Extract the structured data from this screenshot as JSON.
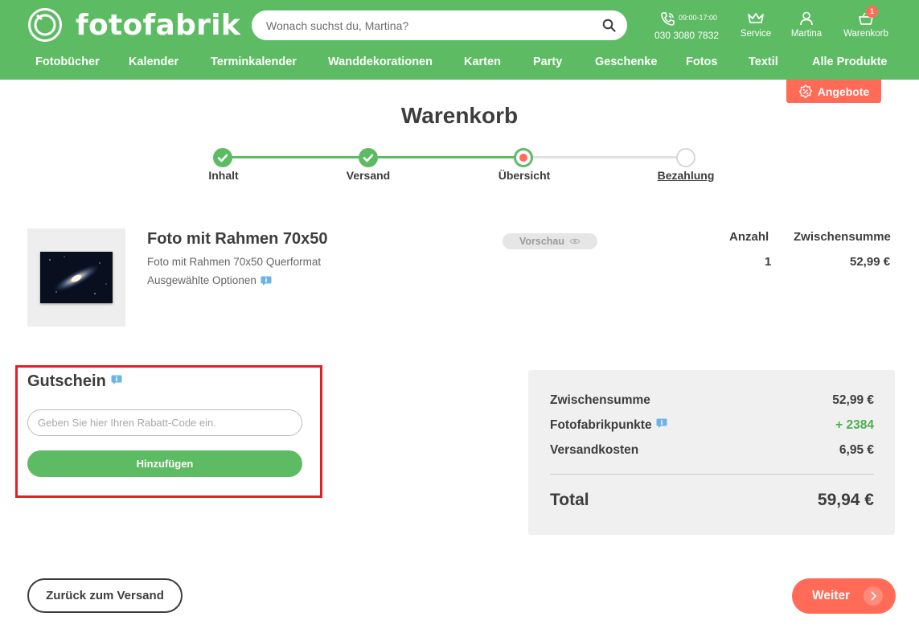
{
  "header": {
    "brand": "fotofabrik",
    "search_placeholder": "Wonach suchst du, Martina?",
    "phone_hours": "09:00-17:00",
    "phone_number": "030 3080 7832",
    "service_label": "Service",
    "user_label": "Martina",
    "cart_label": "Warenkorb",
    "cart_count": "1",
    "brand_color": "#5dbb63"
  },
  "nav": [
    "Fotobücher",
    "Kalender",
    "Terminkalender",
    "Wanddekorationen",
    "Karten",
    "Party",
    "Geschenke",
    "Fotos",
    "Textil",
    "Alle Produkte"
  ],
  "promo_label": "Angebote",
  "page_title": "Warenkorb",
  "steps": [
    {
      "label": "Inhalt",
      "state": "done"
    },
    {
      "label": "Versand",
      "state": "done"
    },
    {
      "label": "Übersicht",
      "state": "current"
    },
    {
      "label": "Bezahlung",
      "state": "todo"
    }
  ],
  "product": {
    "name": "Foto mit Rahmen 70x50",
    "description": "Foto mit Rahmen 70x50 Querformat",
    "options_label": "Ausgewählte Optionen",
    "preview_label": "Vorschau",
    "qty_header": "Anzahl",
    "subtotal_header": "Zwischensumme",
    "qty": "1",
    "subtotal": "52,99 €"
  },
  "voucher": {
    "title": "Gutschein",
    "placeholder": "Geben Sie hier Ihren Rabatt-Code ein.",
    "button_label": "Hinzufügen"
  },
  "summary": {
    "rows": [
      {
        "label": "Zwischensumme",
        "value": "52,99 €"
      },
      {
        "label": "Fotofabrikpunkte",
        "value": "+ 2384"
      },
      {
        "label": "Versandkosten",
        "value": "6,95 €"
      }
    ],
    "total_label": "Total",
    "total_value": "59,94 €"
  },
  "actions": {
    "back_label": "Zurück zum Versand",
    "next_label": "Weiter"
  },
  "colors": {
    "green": "#5dbb63",
    "coral": "#ff6b57",
    "highlight_border": "#e32027"
  }
}
